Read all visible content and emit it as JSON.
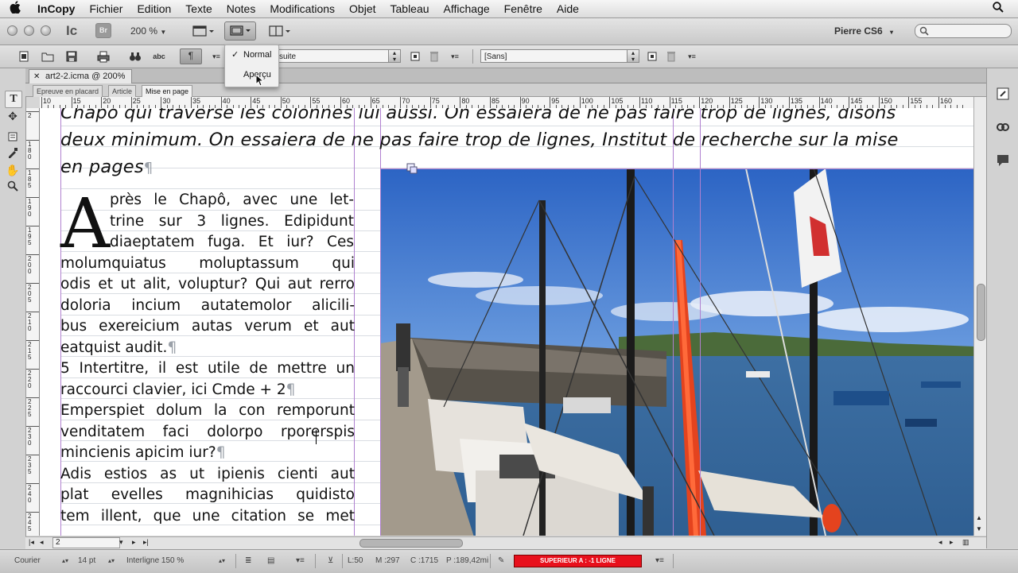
{
  "menubar": {
    "apple": "",
    "items": [
      "InCopy",
      "Fichier",
      "Edition",
      "Texte",
      "Notes",
      "Modifications",
      "Objet",
      "Tableau",
      "Affichage",
      "Fenêtre",
      "Aide"
    ]
  },
  "appbar": {
    "app_logo": "Ic",
    "bridge": "Br",
    "zoom": "200 %",
    "user": "Pierre CS6"
  },
  "view_menu": {
    "items": [
      {
        "label": "Normal",
        "checked": true
      },
      {
        "label": "Aperçu",
        "checked": false
      }
    ]
  },
  "control_bar": {
    "para_style_value": "suite",
    "char_style_value": "[Sans]"
  },
  "document": {
    "tab_title": "art2-2.icma @ 200%",
    "view_tabs": [
      "Epreuve en placard",
      "Article",
      "Mise en page"
    ],
    "active_view": "Mise en page"
  },
  "ruler": {
    "h_labels": [
      "10",
      "15",
      "20",
      "25",
      "30",
      "35",
      "40",
      "45",
      "50",
      "55",
      "60",
      "65",
      "70",
      "75",
      "80",
      "85",
      "90",
      "95",
      "100",
      "105",
      "110",
      "115",
      "120",
      "125",
      "130",
      "135",
      "140",
      "145",
      "150",
      "155",
      "160"
    ],
    "v_labels": [
      "2",
      "1 8 0",
      "1 8 5",
      "1 9 0",
      "1 9 5",
      "2 0 0",
      "2 0 5",
      "2 1 0",
      "2 1 5",
      "2 2 0",
      "2 2 5",
      "2 3 0",
      "2 3 5",
      "2 4 0",
      "2 4 5"
    ]
  },
  "text": {
    "chapo_lines": [
      "Chapo qui traverse les colonnes lui aussi. On essaiera de ne pas faire trop de lignes, disons",
      "deux minimum. On essaiera de ne pas faire trop de lignes, Institut de recherche sur la mise",
      "en pages"
    ],
    "pilcrow": "¶",
    "dropcap": "A",
    "dropcap_lines": [
      "près le Chapô, avec une let-",
      "trine sur 3 lignes. Edipidunt",
      "diaeptatem fuga. Et iur? Ces"
    ],
    "body_lines": [
      "molumquiatus moluptassum qui",
      "odis et ut alit, voluptur? Qui aut rerro",
      "doloria incium autatemolor alicili-",
      "bus exereicium autas verum et aut",
      "eatquist audit.",
      "5 Intertitre, il est utile de mettre un",
      "raccourci clavier, ici Cmde + 2",
      "Emperspiet dolum la con remporunt",
      "venditatem faci dolorpo rporerspis",
      "mincienis apicim iur?",
      "Adis estios as ut ipienis cienti aut",
      "plat evelles magnihicias quidisto",
      "tem illent, que une citation se met"
    ]
  },
  "statusbar": {
    "page_number": "2",
    "font": "Courier",
    "size": "14 pt",
    "leading": "Interligne 150 %",
    "stats": {
      "L": "L:50",
      "M": "M :297",
      "C": "C :1715",
      "P": "P :189,42mi"
    },
    "overset_warning": "SUPERIEUR A : -1 LIGNE",
    "overset_color": "#e8101c"
  },
  "colors": {
    "guide": "#b080d0",
    "menubar": "#e8e8e8"
  }
}
